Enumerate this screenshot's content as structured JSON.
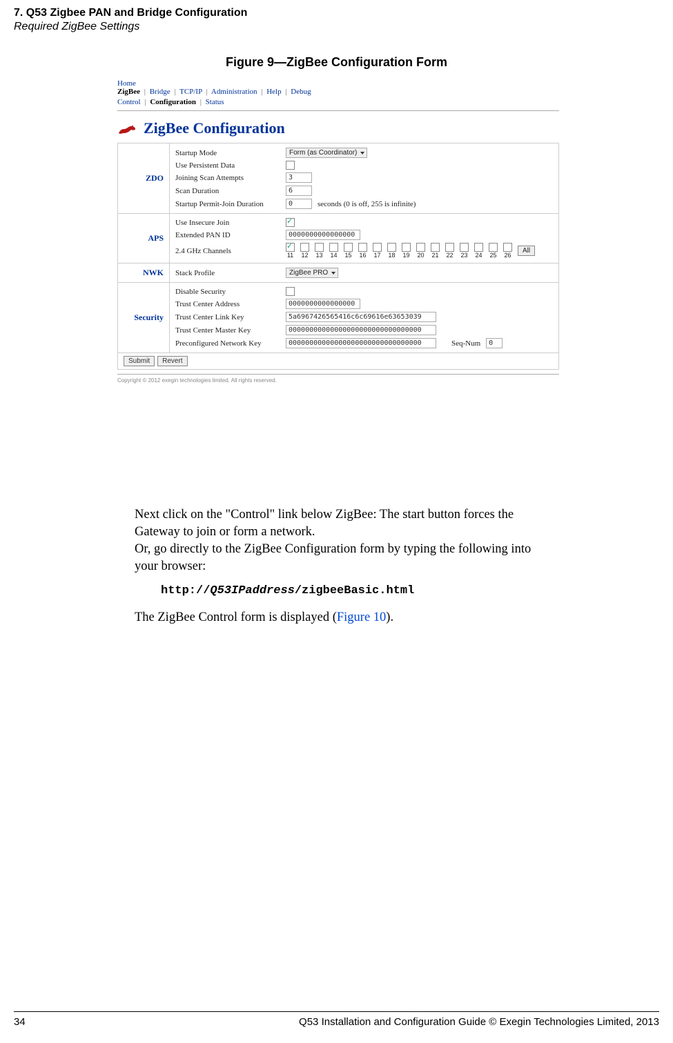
{
  "header": {
    "chapter": "7. Q53 Zigbee PAN and Bridge Configuration",
    "subchapter": "Required ZigBee Settings"
  },
  "figure": {
    "caption": "Figure 9—ZigBee Configuration Form"
  },
  "screenshot": {
    "breadcrumb1": {
      "home": "Home",
      "active": "ZigBee",
      "items": [
        "Bridge",
        "TCP/IP",
        "Administration",
        "Help",
        "Debug"
      ],
      "sep": "|"
    },
    "breadcrumb2": {
      "items": [
        "Control"
      ],
      "active": "Configuration",
      "tail": [
        "Status"
      ],
      "sep": "|"
    },
    "pageTitle": "ZigBee Configuration",
    "sections": {
      "zdo": {
        "name": "ZDO",
        "rows": {
          "startupMode": {
            "label": "Startup Mode",
            "value": "Form (as Coordinator)"
          },
          "usePersistent": {
            "label": "Use Persistent Data"
          },
          "joinScan": {
            "label": "Joining Scan Attempts",
            "value": "3"
          },
          "scanDuration": {
            "label": "Scan Duration",
            "value": "6"
          },
          "permitJoin": {
            "label": "Startup Permit-Join Duration",
            "value": "0",
            "suffix": "seconds (0 is off, 255 is infinite)"
          }
        }
      },
      "aps": {
        "name": "APS",
        "rows": {
          "insecure": {
            "label": "Use Insecure Join"
          },
          "epid": {
            "label": "Extended PAN ID",
            "value": "0000000000000000"
          },
          "channels": {
            "label": "2.4 GHz Channels",
            "items": [
              "11",
              "12",
              "13",
              "14",
              "15",
              "16",
              "17",
              "18",
              "19",
              "20",
              "21",
              "22",
              "23",
              "24",
              "25",
              "26"
            ],
            "allBtn": "All"
          }
        }
      },
      "nwk": {
        "name": "NWK",
        "rows": {
          "stack": {
            "label": "Stack Profile",
            "value": "ZigBee PRO"
          }
        }
      },
      "security": {
        "name": "Security",
        "rows": {
          "disable": {
            "label": "Disable Security"
          },
          "tcAddr": {
            "label": "Trust Center Address",
            "value": "0000000000000000"
          },
          "tcLink": {
            "label": "Trust Center Link Key",
            "value": "5a6967426565416c6c69616e63653039"
          },
          "tcMaster": {
            "label": "Trust Center Master Key",
            "value": "00000000000000000000000000000000"
          },
          "preNwk": {
            "label": "Preconfigured Network Key",
            "value": "00000000000000000000000000000000",
            "seqLabel": "Seq-Num",
            "seqVal": "0"
          }
        }
      }
    },
    "buttons": {
      "submit": "Submit",
      "revert": "Revert"
    },
    "copyright": "Copyright © 2012 exegin technologies limited. All rights reserved."
  },
  "body": {
    "p1a": "Next click on the \"Control\" link below ZigBee: The start button forces the Gateway to join or form a network.",
    "p1b": "Or, go directly to the ZigBee Configuration form by typing the following into your browser:",
    "urlPrefix": "http://",
    "urlVar": "Q53IPaddress",
    "urlSuffix": "/zigbeeBasic.html",
    "p2a": "The ZigBee Control form is displayed (",
    "p2link": "Figure 10",
    "p2b": ")."
  },
  "footer": {
    "pageNum": "34",
    "text": "Q53 Installation and Configuration Guide  © Exegin Technologies Limited, 2013"
  }
}
